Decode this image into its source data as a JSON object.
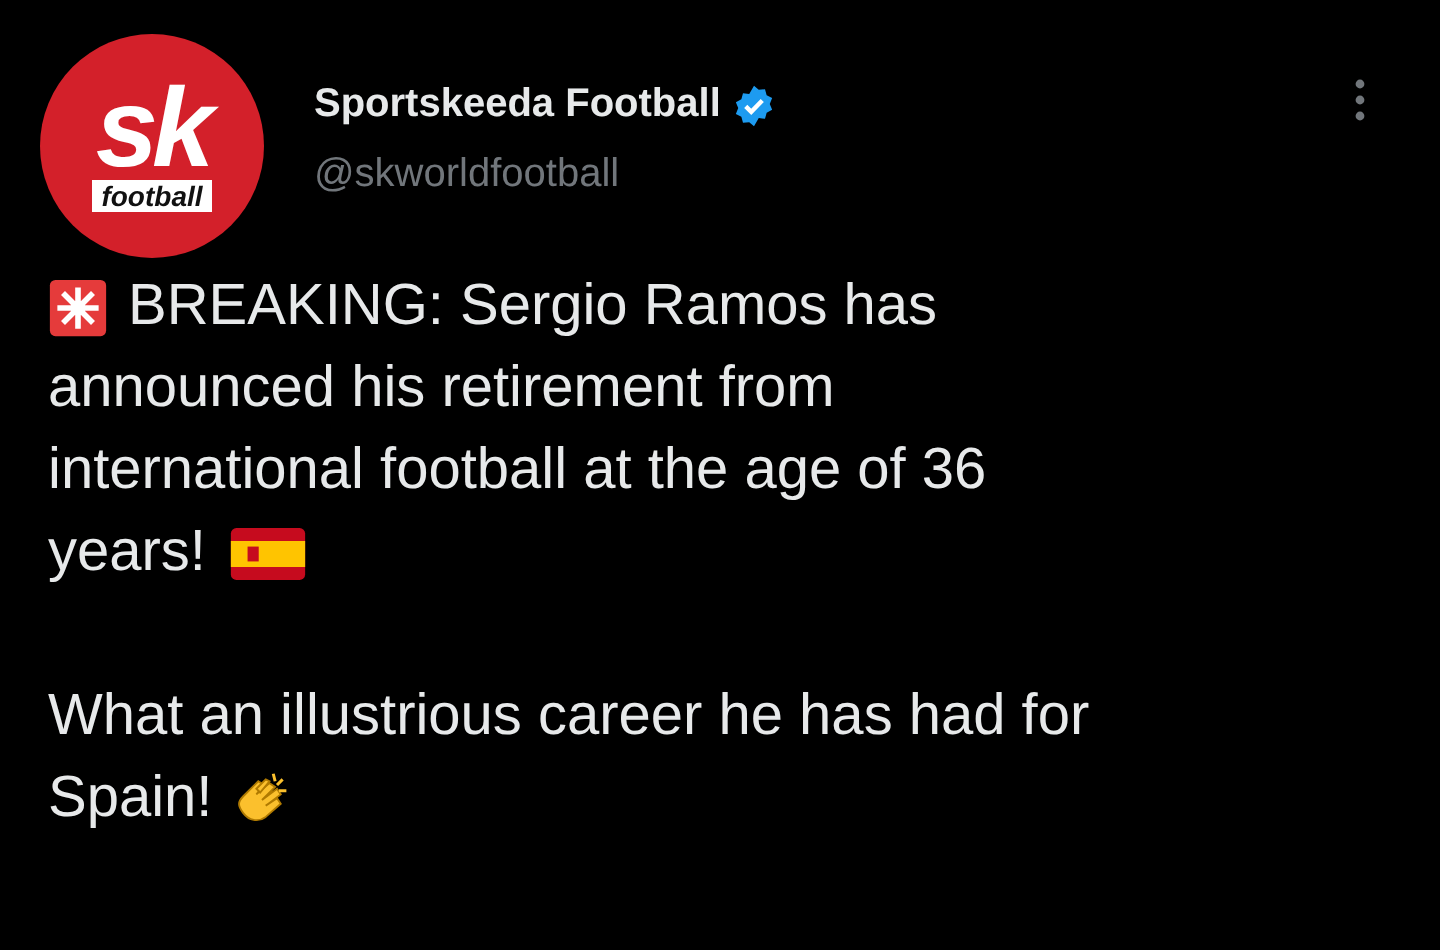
{
  "author": {
    "logo_main": "sk",
    "logo_sub": "football",
    "name": "Sportskeeda Football",
    "verified": true,
    "handle": "@skworldfootball"
  },
  "text": {
    "paragraphs": [
      [
        "BREAKING: Sergio Ramos has",
        "announced his retirement from",
        "international football at the age of 36",
        "years!"
      ],
      [
        "What an illustrious career he has had for",
        "Spain!"
      ]
    ]
  }
}
